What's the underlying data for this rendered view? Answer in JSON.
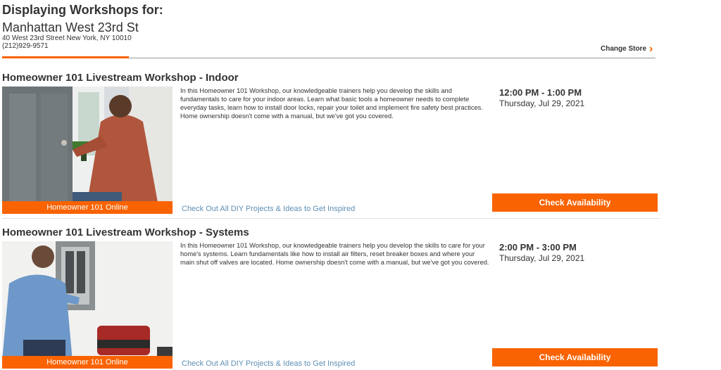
{
  "header": {
    "title": "Displaying Workshops for:",
    "store_name": "Manhattan West 23rd St",
    "address": "40 West 23rd Street New York, NY 10010",
    "phone": "(212)929-9571",
    "change_store_label": "Change Store",
    "chevron_icon": "chevron-right-icon",
    "accent_color": "#f96302"
  },
  "workshops": [
    {
      "title": "Homeowner 101 Livestream Workshop - Indoor",
      "image_tag": "Homeowner 101 Online",
      "description": "In this Homeowner 101 Workshop, our knowledgeable trainers help you develop the skills and fundamentals to care for your indoor areas. Learn what basic tools a homeowner needs to complete everyday tasks, learn how to install door locks, repair your toilet and implement fire safety best practices. Home ownership doesn't come with a manual, but we've got you covered.",
      "link_text": "Check Out All DIY Projects & Ideas to Get Inspired",
      "time": "12:00 PM - 1:00 PM",
      "date": "Thursday, Jul 29, 2021",
      "button_label": "Check Availability"
    },
    {
      "title": "Homeowner 101 Livestream Workshop - Systems",
      "image_tag": "Homeowner 101 Online",
      "description": "In this Homeowner 101 Workshop, our knowledgeable trainers help you develop the skills to care for your home's systems. Learn fundamentals like how to install air filters, reset breaker boxes and where your main shut off valves are located. Home ownership doesn't come with a manual, but we've got you covered.",
      "link_text": "Check Out All DIY Projects & Ideas to Get Inspired",
      "time": "2:00 PM - 3:00 PM",
      "date": "Thursday, Jul 29, 2021",
      "button_label": "Check Availability"
    }
  ]
}
